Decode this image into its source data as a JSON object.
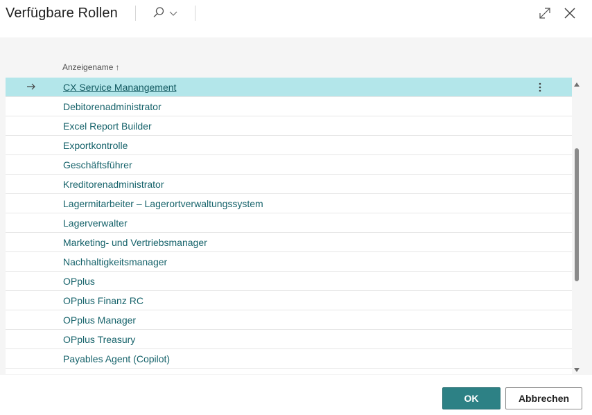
{
  "dialog": {
    "title": "Verfügbare Rollen"
  },
  "toolbar": {
    "search_icon": "search-icon",
    "expand_icon": "expand-icon",
    "close_icon": "close-icon"
  },
  "list": {
    "column_header": "Anzeigename",
    "sort_indicator": "↑",
    "rows": [
      {
        "label": "CX Service Manangement",
        "selected": true
      },
      {
        "label": "Debitorenadministrator"
      },
      {
        "label": "Excel Report Builder"
      },
      {
        "label": "Exportkontrolle"
      },
      {
        "label": "Geschäftsführer"
      },
      {
        "label": "Kreditorenadministrator"
      },
      {
        "label": "Lagermitarbeiter – Lagerortverwaltungssystem"
      },
      {
        "label": "Lagerverwalter"
      },
      {
        "label": "Marketing- und Vertriebsmanager"
      },
      {
        "label": "Nachhaltigkeitsmanager"
      },
      {
        "label": "OPplus"
      },
      {
        "label": "OPplus Finanz RC"
      },
      {
        "label": "OPplus Manager"
      },
      {
        "label": "OPplus Treasury"
      },
      {
        "label": "Payables Agent (Copilot)"
      },
      {
        "label": ""
      }
    ]
  },
  "footer": {
    "ok_label": "OK",
    "cancel_label": "Abbrechen"
  },
  "colors": {
    "accent": "#2d8185",
    "selected_row": "#b3e6ea",
    "link_text": "#15626a"
  }
}
